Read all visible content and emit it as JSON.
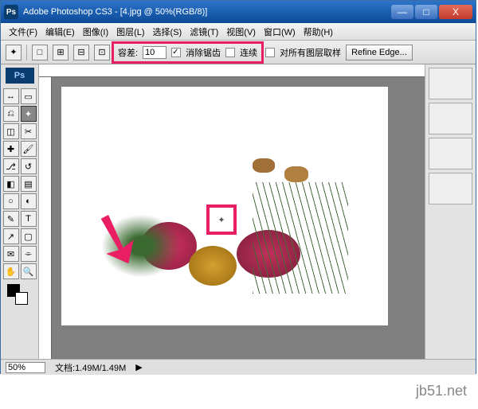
{
  "title": "Adobe Photoshop CS3 - [4.jpg @ 50%(RGB/8)]",
  "win_controls": {
    "min": "—",
    "max": "□",
    "close": "X"
  },
  "menu": [
    "文件(F)",
    "编辑(E)",
    "图像(I)",
    "图层(L)",
    "选择(S)",
    "滤镜(T)",
    "视图(V)",
    "窗口(W)",
    "帮助(H)"
  ],
  "options": {
    "tolerance_label": "容差:",
    "tolerance_value": "10",
    "antialias": "消除锯齿",
    "antialias_checked": true,
    "contiguous": "连续",
    "contiguous_checked": false,
    "sample_all": "对所有图层取样",
    "sample_all_checked": false,
    "refine": "Refine Edge..."
  },
  "ps_logo": "Ps",
  "tools": [
    {
      "name": "move",
      "glyph": "↔"
    },
    {
      "name": "marquee",
      "glyph": "▭"
    },
    {
      "name": "lasso",
      "glyph": "⎌"
    },
    {
      "name": "wand",
      "glyph": "✦",
      "selected": true
    },
    {
      "name": "crop",
      "glyph": "◫"
    },
    {
      "name": "slice",
      "glyph": "✂"
    },
    {
      "name": "heal",
      "glyph": "✚"
    },
    {
      "name": "brush",
      "glyph": "🖌"
    },
    {
      "name": "stamp",
      "glyph": "⎇"
    },
    {
      "name": "history",
      "glyph": "↺"
    },
    {
      "name": "eraser",
      "glyph": "◧"
    },
    {
      "name": "gradient",
      "glyph": "▤"
    },
    {
      "name": "blur",
      "glyph": "○"
    },
    {
      "name": "dodge",
      "glyph": "◐"
    },
    {
      "name": "pen",
      "glyph": "✎"
    },
    {
      "name": "type",
      "glyph": "T"
    },
    {
      "name": "path",
      "glyph": "↗"
    },
    {
      "name": "shape",
      "glyph": "▢"
    },
    {
      "name": "notes",
      "glyph": "✉"
    },
    {
      "name": "eyedrop",
      "glyph": "⌯"
    },
    {
      "name": "hand",
      "glyph": "✋"
    },
    {
      "name": "zoom",
      "glyph": "🔍"
    }
  ],
  "status": {
    "zoom": "50%",
    "doc_label": "文档:",
    "doc": "1.49M/1.49M"
  },
  "watermark": "jb51.net"
}
